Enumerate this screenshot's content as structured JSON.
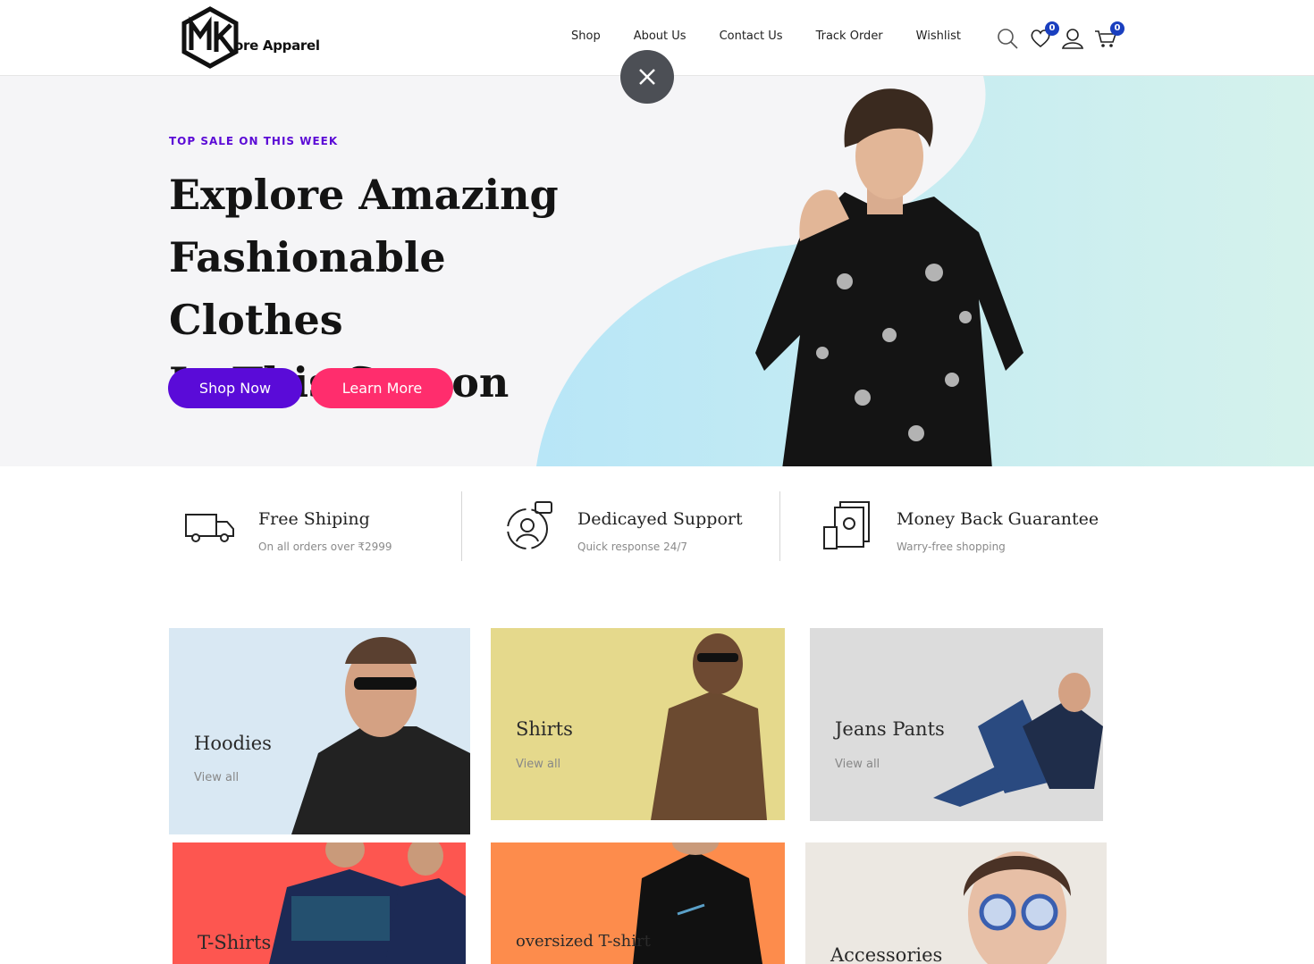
{
  "brand": {
    "logo_text": "ore Apparel"
  },
  "nav": [
    "Shop",
    "About Us",
    "Contact Us",
    "Track Order",
    "Wishlist"
  ],
  "header_icons": {
    "wishlist_count": "0",
    "cart_count": "0"
  },
  "hero": {
    "tag": "TOP SALE ON THIS WEEK",
    "title_lines": [
      "Explore Amazing",
      "Fashionable Clothes",
      "In This Season"
    ],
    "shop_btn": "Shop Now",
    "learn_btn": "Learn More"
  },
  "features": [
    {
      "title": "Free Shiping",
      "sub": "On all orders over ₹2999",
      "icon": "truck-icon"
    },
    {
      "title": "Dedicayed Support",
      "sub": "Quick response 24/7",
      "icon": "support-icon"
    },
    {
      "title": "Money Back Guarantee",
      "sub": "Warry-free shopping",
      "icon": "money-icon"
    }
  ],
  "categories": [
    {
      "title": "Hoodies",
      "link": "View all",
      "bg": "#d9e8f3"
    },
    {
      "title": "Shirts",
      "link": "View all",
      "bg": "#e5d98c"
    },
    {
      "title": "Jeans Pants",
      "link": "View all",
      "bg": "#dcdcdc"
    },
    {
      "title": "T-Shirts",
      "link": "",
      "bg": "#fd5650"
    },
    {
      "title": "oversized T-shirt",
      "link": "",
      "bg": "#fd8c4c"
    },
    {
      "title": "Accessories",
      "link": "",
      "bg": "#ece8e2"
    }
  ],
  "colors": {
    "accent_purple": "#5a0bd8",
    "accent_pink": "#ff2d6d",
    "badge_blue": "#1a3fbf",
    "hero_blob": "#bde9f5"
  }
}
